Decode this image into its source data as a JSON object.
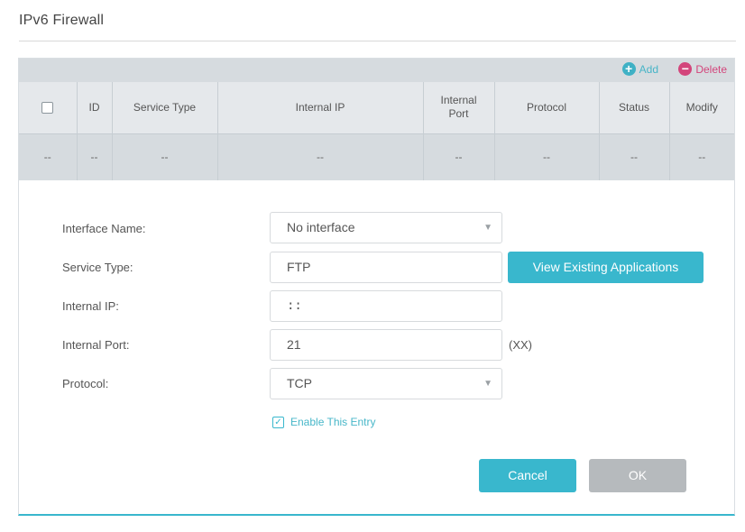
{
  "page": {
    "title": "IPv6 Firewall"
  },
  "toolbar": {
    "add_label": "Add",
    "add_icon": "plus-circle-icon",
    "delete_label": "Delete",
    "delete_icon": "minus-circle-icon"
  },
  "table": {
    "headers": [
      "",
      "ID",
      "Service Type",
      "Internal IP",
      "Internal Port",
      "Protocol",
      "Status",
      "Modify"
    ],
    "rows": [
      [
        "--",
        "--",
        "--",
        "--",
        "--",
        "--",
        "--",
        "--"
      ]
    ]
  },
  "form": {
    "interface": {
      "label": "Interface Name:",
      "value": "No interface"
    },
    "service": {
      "label": "Service Type:",
      "value": "FTP",
      "button": "View Existing Applications"
    },
    "ip": {
      "label": "Internal IP:",
      "value": "::"
    },
    "port": {
      "label": "Internal Port:",
      "value": "21",
      "suffix": "(XX)"
    },
    "protocol": {
      "label": "Protocol:",
      "value": "TCP"
    },
    "enable": {
      "label": "Enable This Entry",
      "checked": true
    }
  },
  "buttons": {
    "cancel": "Cancel",
    "ok": "OK"
  },
  "colors": {
    "accent": "#39b7cd",
    "delete": "#d3457b",
    "disabled": "#b6babd"
  }
}
